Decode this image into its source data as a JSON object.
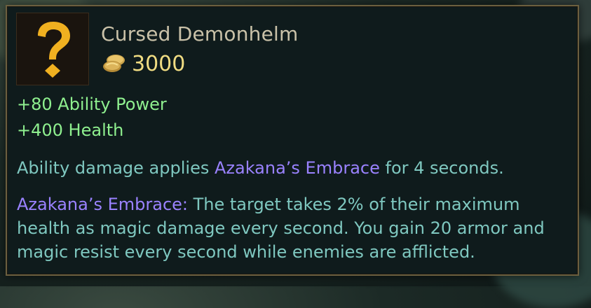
{
  "item": {
    "name": "Cursed Demonhelm",
    "icon": "question-mark-icon",
    "gold_icon": "gold-coins-icon",
    "cost": "3000"
  },
  "stats": [
    "+80 Ability Power",
    "+400 Health"
  ],
  "passive": {
    "line_prefix": "Ability damage applies ",
    "line_keyword": "Azakana’s Embrace",
    "line_suffix": " for 4 seconds."
  },
  "effect": {
    "keyword": "Azakana’s Embrace:",
    "text": " The target takes 2% of their maximum health as magic damage every second. You gain 20 armor and magic resist every second while enemies are afflicted."
  },
  "colors": {
    "stat": "#8ff08f",
    "description": "#7fc8c0",
    "keyword": "#9a82ff",
    "gold": "#f0dc82",
    "title": "#c9c1a8",
    "border": "#6b5f3f"
  }
}
